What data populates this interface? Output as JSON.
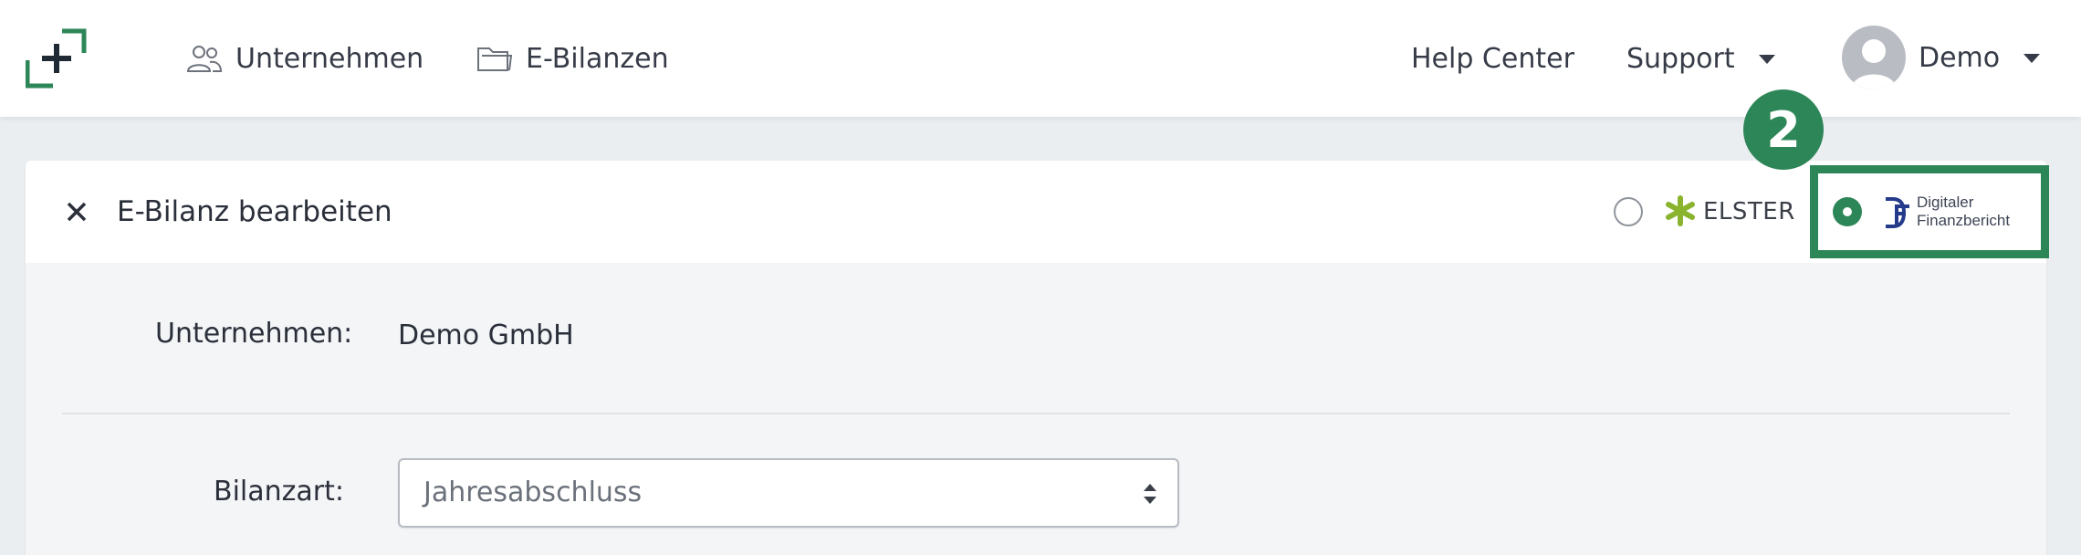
{
  "navbar": {
    "items": [
      {
        "label": "Unternehmen",
        "icon": "users-icon"
      },
      {
        "label": "E-Bilanzen",
        "icon": "folder-icon"
      }
    ],
    "help_center": "Help Center",
    "support": "Support",
    "user": "Demo"
  },
  "step_badge": "2",
  "card": {
    "title": "E-Bilanz bearbeiten",
    "options": {
      "elster": {
        "label": "ELSTER",
        "selected": false
      },
      "digitaler_finanzbericht": {
        "line1": "Digitaler",
        "line2": "Finanzbericht",
        "selected": true
      }
    }
  },
  "form": {
    "company_label": "Unternehmen:",
    "company_value": "Demo GmbH",
    "bilanzart_label": "Bilanzart:",
    "bilanzart_value": "Jahresabschluss"
  },
  "colors": {
    "accent_green": "#2d8657",
    "elster_green": "#8ab42e",
    "df_blue": "#243a8a"
  }
}
